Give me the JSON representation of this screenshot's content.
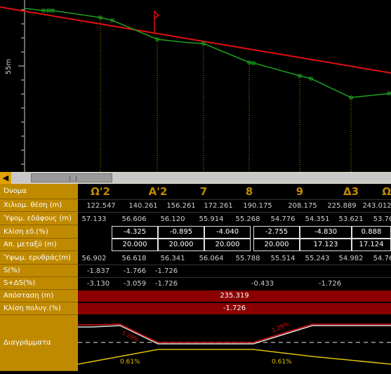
{
  "profile": {
    "y_axis_label": "55m",
    "stations": [
      "Ω'2",
      "Α'2",
      "7",
      "8",
      "9",
      "Δ3",
      "Ω'"
    ]
  },
  "scroll": {
    "left_arrow": "◀"
  },
  "table": {
    "labels": {
      "name": "Όνομα",
      "chainage": "Χιλιομ. θέση (m)",
      "ground": "Ύψομ. εδάφους (m)",
      "slope": "Κλίση εδ.(%)",
      "dist": "Απ. μεταξύ (m)",
      "red": "Ύψωμ. ερυθράς(m)",
      "s": "S(%)",
      "sds": "S+ΔS(%)",
      "distance": "Απόσταση (m)",
      "poly": "Κλίση πολυγ.(%)",
      "diagrams": "Διαγράμματα"
    },
    "chainage": [
      "122.547",
      "140.261",
      "156.261",
      "172.261",
      "190.175",
      "208.175",
      "225.889",
      "243.012"
    ],
    "ground": [
      "57.133",
      "56.606",
      "56.120",
      "55.914",
      "55.268",
      "54.776",
      "54.351",
      "53.621",
      "53.76"
    ],
    "slope": [
      "-4.325",
      "-0.895",
      "-4.040",
      "-2.755",
      "-4.830",
      "0.888"
    ],
    "dist": [
      "20.000",
      "20.000",
      "20.000",
      "20.000",
      "17.123",
      "17.124"
    ],
    "red": [
      "56.902",
      "56.618",
      "56.341",
      "56.064",
      "55.788",
      "55.514",
      "55.243",
      "54.982",
      "54.76"
    ],
    "s": [
      "-1.837",
      "-1.766",
      "-1.726"
    ],
    "sds": [
      "-3.130",
      "-3.059",
      "-1.726",
      "-0.433",
      "-1.726"
    ],
    "distance_value": "235.319",
    "poly_value": "-1.726"
  },
  "diagram": {
    "label_left_top": "1.29%",
    "label_right_top": "1.29%",
    "label_left_bottom": "0.61%",
    "label_right_bottom": "0.61%"
  },
  "colors": {
    "label_bg": "#c08a00",
    "red_line": "#e01010",
    "green_line": "#1ea01e",
    "red_row": "#8b0000",
    "yellow": "#e0c000"
  }
}
